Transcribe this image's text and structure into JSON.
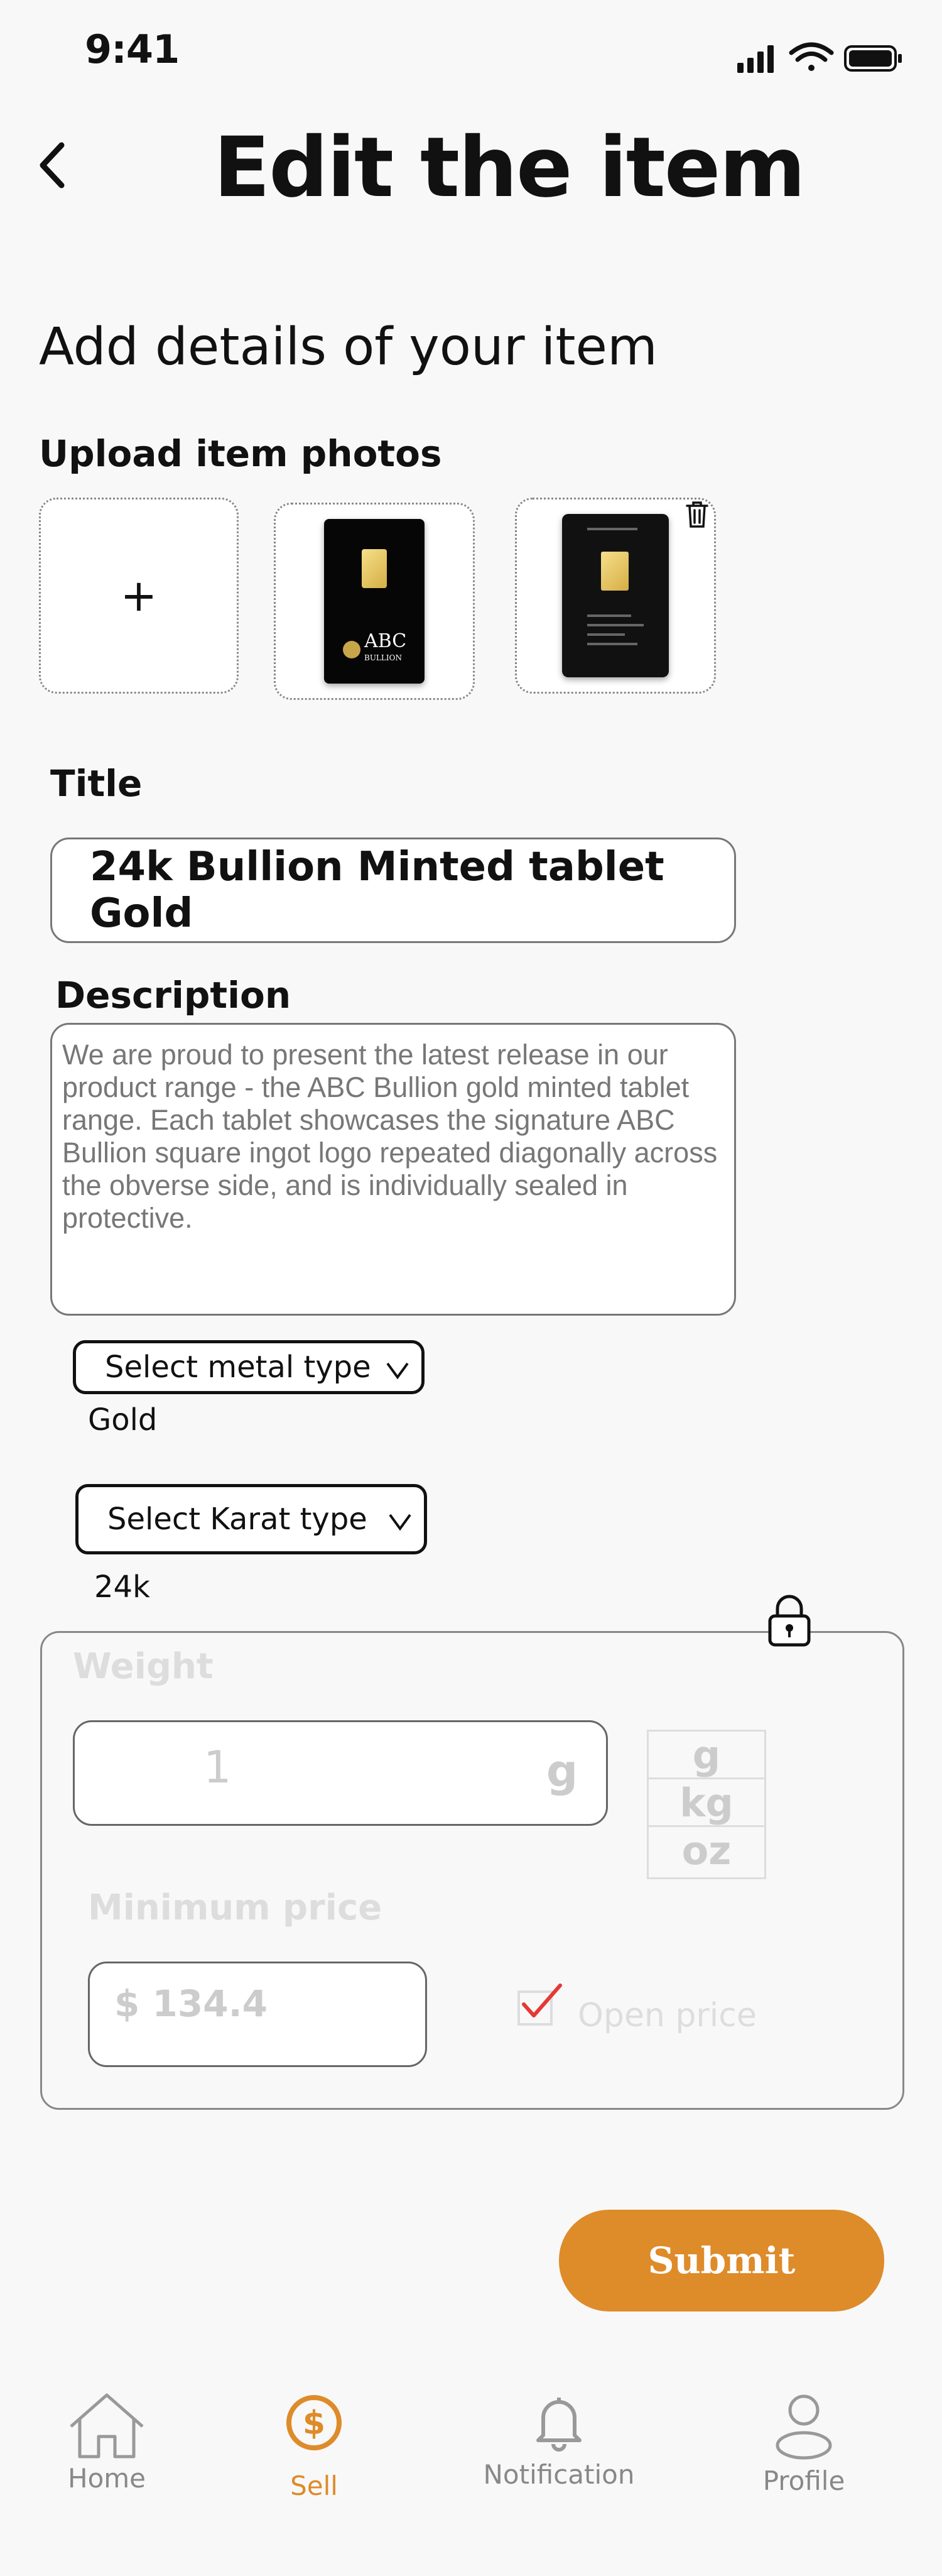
{
  "status_bar": {
    "time": "9:41"
  },
  "header": {
    "title": "Edit the item"
  },
  "section_heading": "Add details of your item",
  "photos": {
    "label": "Upload item photos",
    "add_symbol": "+",
    "item1_logo_text": "ABC",
    "item1_logo_subtext": "BULLION"
  },
  "form": {
    "title_label": "Title",
    "title_value": "24k Bullion Minted tablet Gold",
    "description_label": "Description",
    "description_value": "We are proud to present the latest release in our product range - the ABC Bullion gold minted tablet range. Each tablet showcases the signature ABC Bullion square ingot logo repeated diagonally across the obverse side, and is individually sealed in protective.",
    "metal_select_label": "Select metal type",
    "metal_value": "Gold",
    "karat_select_label": "Select Karat type",
    "karat_value": "24k"
  },
  "locked_panel": {
    "weight_label": "Weight",
    "weight_value": "1",
    "weight_unit": "g",
    "unit_options": [
      "g",
      "kg",
      "oz"
    ],
    "min_price_label": "Minimum price",
    "min_price_value": "$ 134.4",
    "open_price_label": "Open price",
    "open_price_checked": true
  },
  "submit_label": "Submit",
  "bottom_nav": [
    {
      "label": "Home",
      "icon": "home-icon",
      "active": false
    },
    {
      "label": "Sell",
      "icon": "dollar-circle-icon",
      "active": true
    },
    {
      "label": "Notification",
      "icon": "bell-icon",
      "active": false
    },
    {
      "label": "Profile",
      "icon": "user-icon",
      "active": false
    }
  ],
  "colors": {
    "accent": "#de8b29",
    "check": "#e53935",
    "muted": "#dddddd"
  }
}
